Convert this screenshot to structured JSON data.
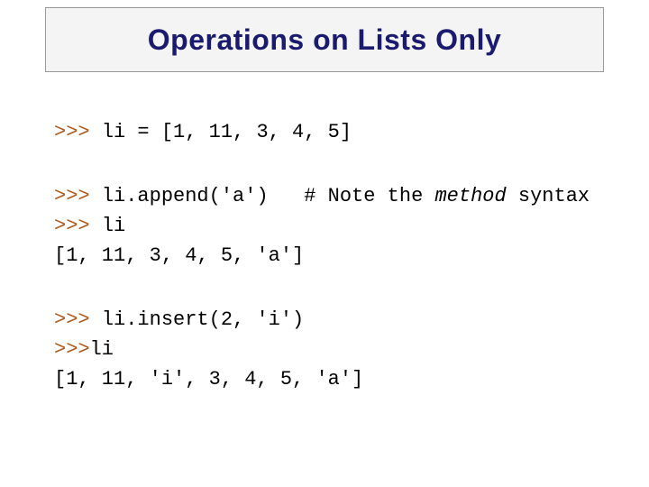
{
  "title": "Operations on Lists Only",
  "code": {
    "block1": {
      "prompt1": ">>> ",
      "line1": "li = [1, 11, 3, 4, 5]"
    },
    "block2": {
      "prompt1": ">>> ",
      "line1a": "li.append('a')   # Note the ",
      "line1b": "method",
      "line2": " syntax",
      "prompt2": ">>> ",
      "line3": "li",
      "line4": "[1, 11, 3, 4, 5, 'a']"
    },
    "block3": {
      "prompt1": ">>> ",
      "line1": "li.insert(2, 'i')",
      "prompt2": ">>>",
      "line2": "li",
      "line3": "[1, 11, 'i', 3, 4, 5, 'a']"
    }
  }
}
